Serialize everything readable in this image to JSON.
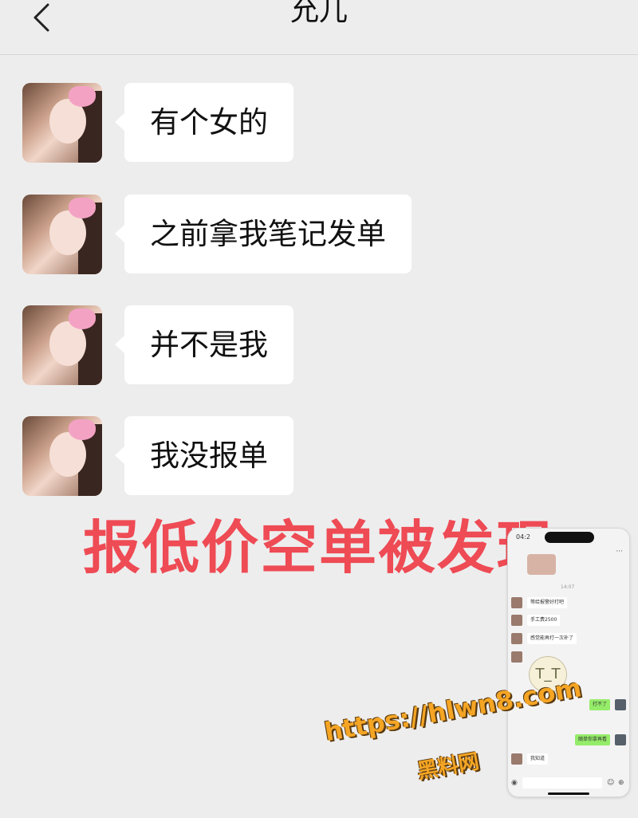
{
  "header": {
    "title": "允儿",
    "back_icon": "chevron-left-icon"
  },
  "messages": [
    {
      "text": "有个女的"
    },
    {
      "text": "之前拿我笔记发单"
    },
    {
      "text": "并不是我"
    },
    {
      "text": "我没报单"
    }
  ],
  "overlay": {
    "caption": "报低价空单被发现",
    "caption_color": "#ee4b55"
  },
  "inset_phone": {
    "time": "04:2",
    "timestamp": "14:07",
    "messages": [
      {
        "side": "left",
        "text": "等给报警好打吧"
      },
      {
        "side": "left",
        "text": "手工费2500"
      },
      {
        "side": "left",
        "text": "感觉能再打一次补了"
      },
      {
        "side": "right",
        "text": "打不了"
      },
      {
        "side": "right",
        "text": "随单你拿再看"
      },
      {
        "side": "left",
        "text": "我知道"
      }
    ]
  },
  "watermark": {
    "url": "https://hlwn8.com",
    "site": "黑料网",
    "color": "#f5a524"
  }
}
